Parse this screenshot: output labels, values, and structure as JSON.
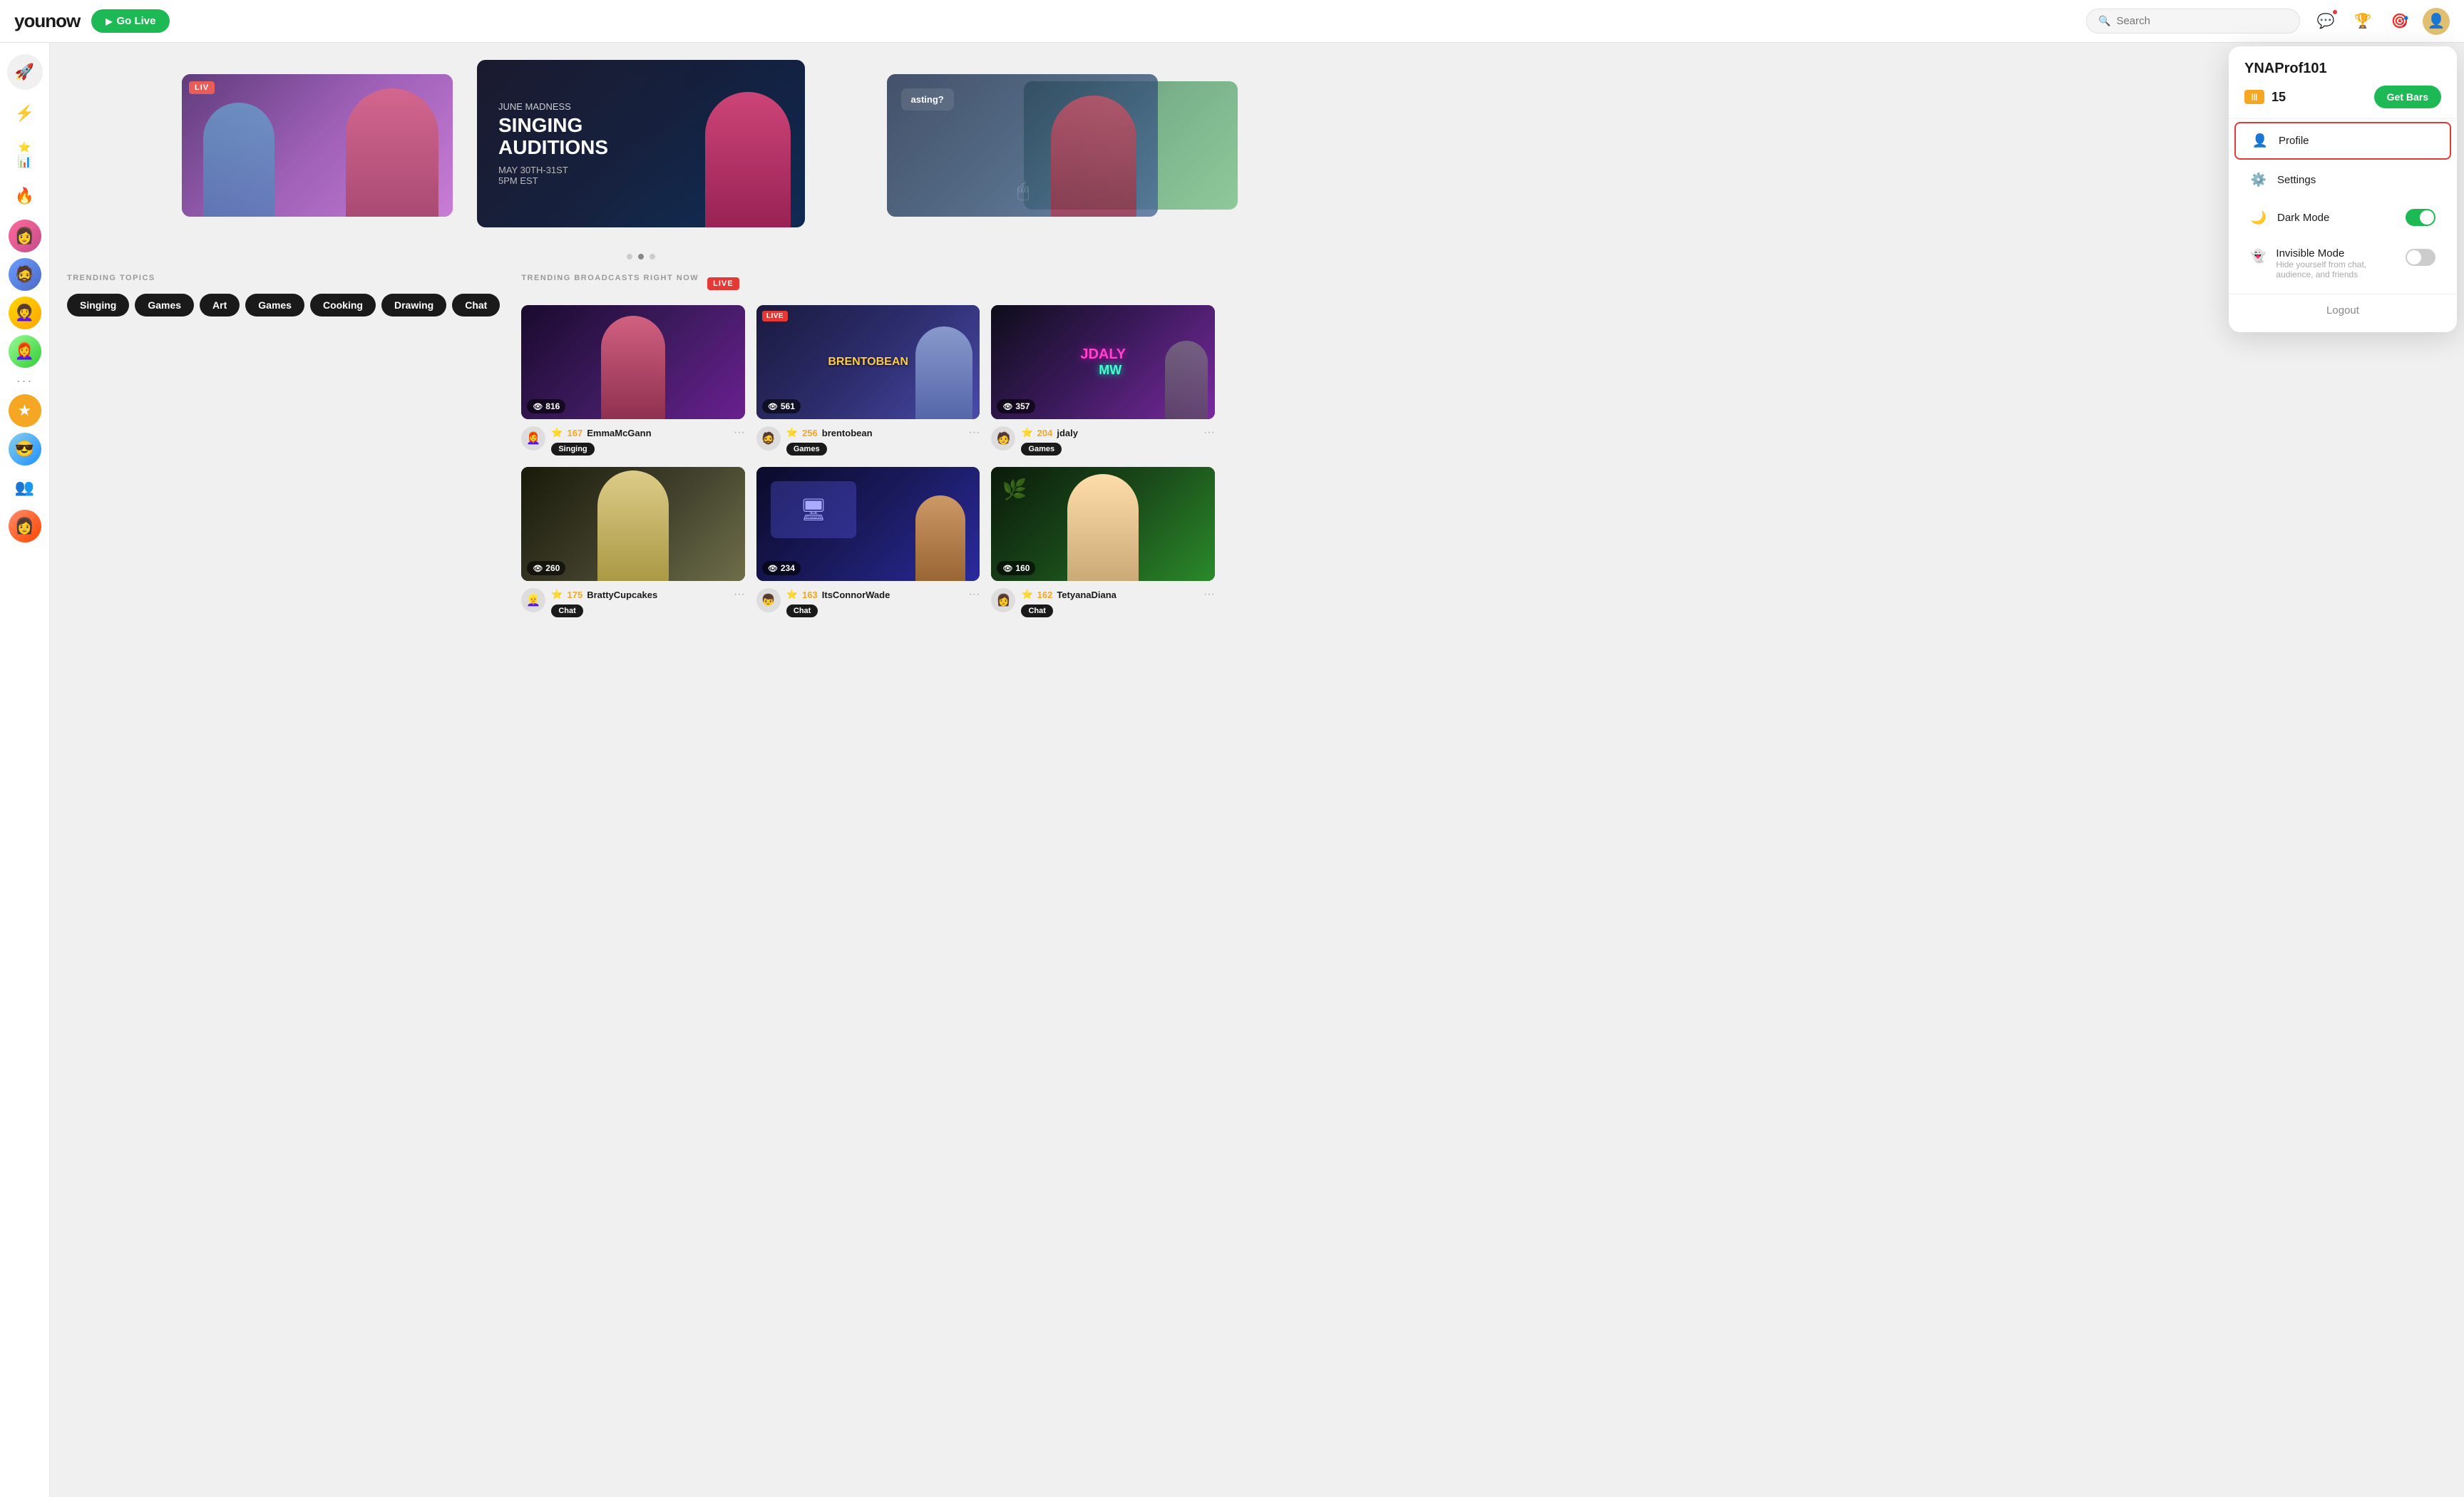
{
  "header": {
    "logo": "younow",
    "go_live_label": "Go Live",
    "search_placeholder": "Search",
    "icons": {
      "chat_icon": "💬",
      "trophy_icon": "🏆",
      "points_icon": "🎯"
    }
  },
  "sidebar": {
    "icons": [
      "🚀",
      "⚡",
      "⭐",
      "📊",
      "🔥"
    ],
    "avatars": [
      "👩",
      "👨",
      "👩‍🦱",
      "👩‍🦰",
      "👤",
      "😎"
    ],
    "dots_label": "...",
    "star_label": "★",
    "friends_icon": "👥"
  },
  "carousel": {
    "live_label": "LIVE",
    "main": {
      "subtitle": "JUNE MADNESS",
      "title": "SINGING\nAUDITIONS",
      "date": "MAY 30TH-31ST\n5PM EST"
    },
    "dots": [
      "",
      "",
      ""
    ]
  },
  "trending_topics": {
    "title": "TRENDING TOPICS",
    "tags": [
      "Singing",
      "Games",
      "Art",
      "Games",
      "Cooking",
      "Drawing",
      "Chat"
    ]
  },
  "trending_broadcasts": {
    "title": "TRENDING BROADCASTS RIGHT NOW",
    "live_label": "LIVE",
    "broadcasts": [
      {
        "viewers": "816",
        "score": "167",
        "name": "EmmaMcGann",
        "category": "Singing",
        "avatar": "👩‍🦰"
      },
      {
        "viewers": "561",
        "score": "256",
        "name": "brentobean",
        "category": "Games",
        "avatar": "🧔",
        "overlay": "BRENTOBEAN",
        "live": "LIVE"
      },
      {
        "viewers": "357",
        "score": "204",
        "name": "jdaly",
        "category": "Games",
        "avatar": "🧑",
        "overlay": "JDALY",
        "overlay2": "MW"
      },
      {
        "viewers": "260",
        "score": "175",
        "name": "BrattyCupcakes",
        "category": "Chat",
        "avatar": "👱‍♀️"
      },
      {
        "viewers": "234",
        "score": "163",
        "name": "ItsConnorWade",
        "category": "Chat",
        "avatar": "👦"
      },
      {
        "viewers": "160",
        "score": "162",
        "name": "TetyanaDiana",
        "category": "Chat",
        "avatar": "👩"
      }
    ]
  },
  "dropdown": {
    "username": "YNAProf101",
    "bars_count": "15",
    "get_bars_label": "Get Bars",
    "items": [
      {
        "icon": "person",
        "label": "Profile",
        "active": true
      },
      {
        "icon": "gear",
        "label": "Settings"
      },
      {
        "icon": "moon",
        "label": "Dark Mode",
        "toggle": "on"
      },
      {
        "icon": "invisible",
        "label": "Invisible Mode",
        "toggle": "off",
        "sub": "Hide yourself from chat, audience, and friends"
      }
    ],
    "logout_label": "Logout"
  }
}
